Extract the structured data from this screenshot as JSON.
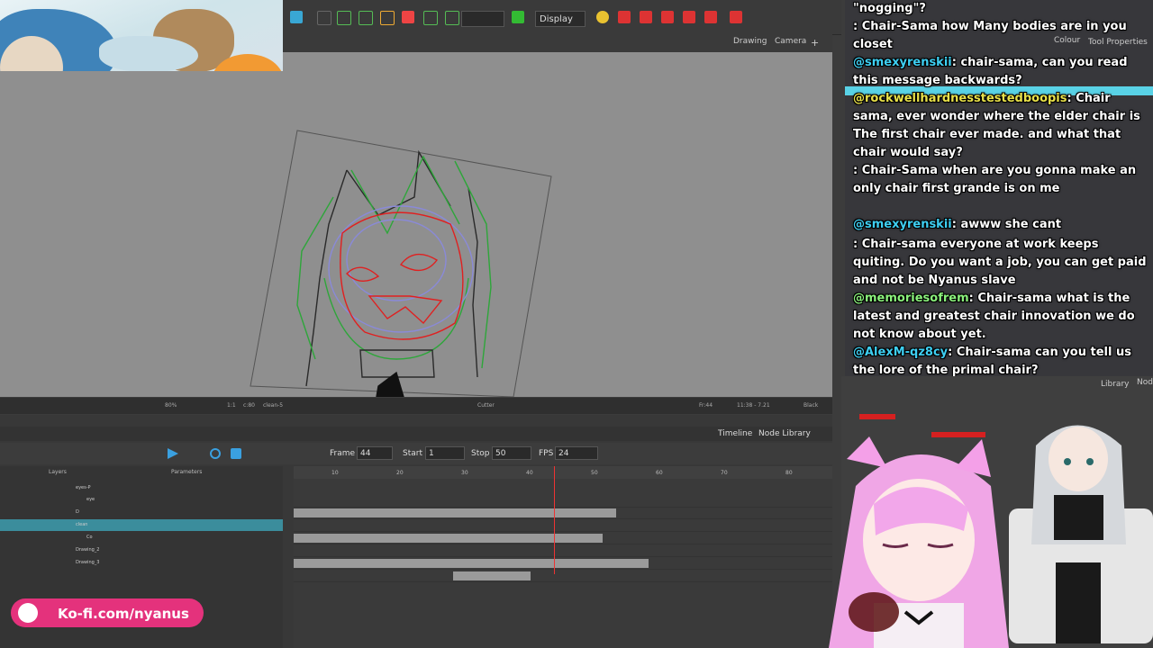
{
  "toolbar": {
    "display_select": "Display"
  },
  "view": {
    "tabs": [
      "Drawing",
      "Camera"
    ],
    "status": [
      "80%",
      "1:1",
      "c:80",
      "clean-5",
      "Cutter",
      "Fr:44",
      "11:38 - 7.21",
      "Black"
    ]
  },
  "timeline": {
    "tabs": [
      "Timeline",
      "Node Library"
    ],
    "frame_label": "Frame",
    "frame_value": "44",
    "start_label": "Start",
    "start_value": "1",
    "stop_label": "Stop",
    "stop_value": "50",
    "fps_label": "FPS",
    "fps_value": "24",
    "layers_header": "Layers",
    "params_header": "Parameters",
    "ruler": [
      "10",
      "20",
      "30",
      "40",
      "50",
      "60",
      "70",
      "80"
    ],
    "layers": [
      {
        "name": "eyes-P"
      },
      {
        "name": "eye"
      },
      {
        "name": "D"
      },
      {
        "name": "clean",
        "selected": true
      },
      {
        "name": "Co"
      },
      {
        "name": "Drawing_2"
      },
      {
        "name": "Drawing_3"
      }
    ]
  },
  "side_panel": {
    "tabs": [
      "Colour",
      "Tool Properties"
    ],
    "library_tab": "Library",
    "node_tab": "Node"
  },
  "chat": [
    {
      "name": "",
      "text": "\"nogging\"?"
    },
    {
      "name": "",
      "text": ": Chair-Sama how Many bodies are in you closet",
      "nameColor": "b"
    },
    {
      "name": "@smexyrenskii",
      "text": ": chair-sama, can you read this message backwards?"
    },
    {
      "name": "@rockwellhardnesstestedboopis",
      "text": ": Chair sama, ever wonder where the elder chair is The first chair ever made. and what that chair would say?",
      "nameColor": "y"
    },
    {
      "name": "",
      "text": ": Chair-Sama when are you gonna make an only chair first grande is on me",
      "nameColor": "b"
    },
    {
      "name": "@smexyrenskii",
      "text": ": awww she cant"
    },
    {
      "name": "",
      "text": ": Chair-sama everyone at work keeps quiting. Do you want a job, you can get paid and not be Nyanus slave",
      "nameColor": "b"
    },
    {
      "name": "@memoriesofrem",
      "text": ": Chair-sama what is the latest and greatest chair innovation we do not know about yet.",
      "nameColor": "g"
    },
    {
      "name": "@AlexM-qz8cy",
      "text": ": Chair-sama can you tell us the lore of the primal chair?"
    }
  ],
  "kofi": {
    "label": "Ko-fi.com/nyanus"
  }
}
